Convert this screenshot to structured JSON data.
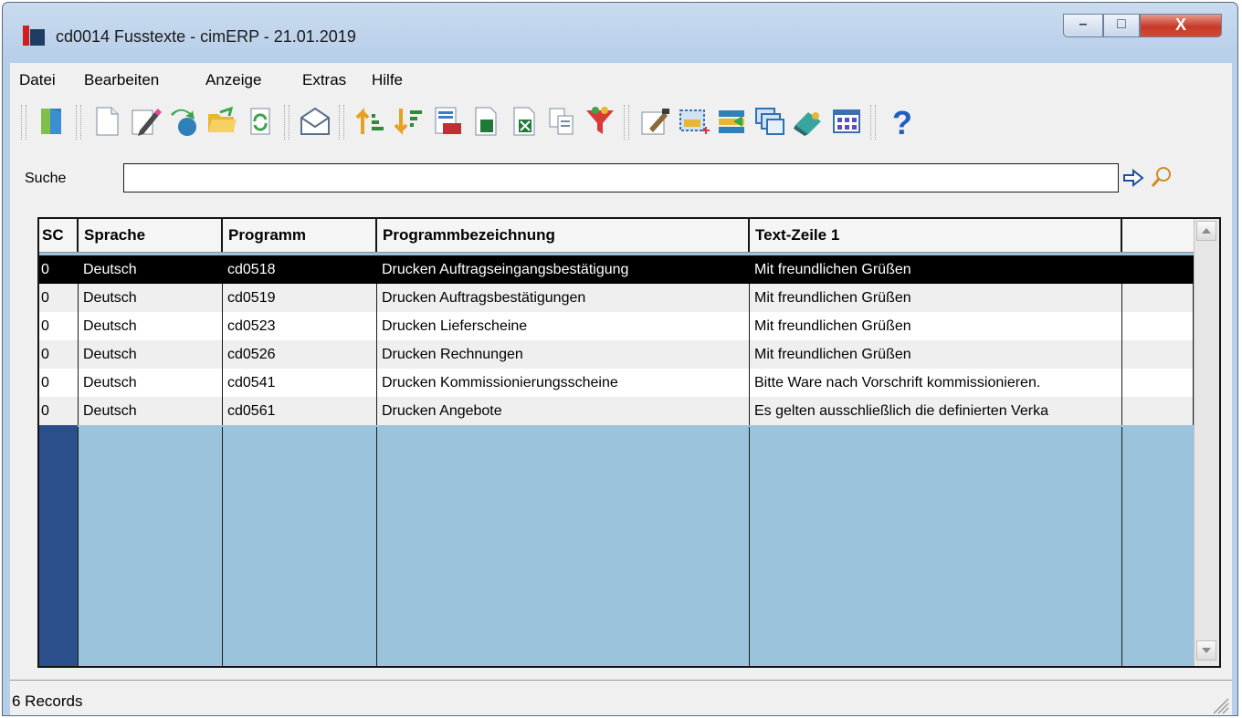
{
  "window": {
    "title": "cd0014 Fusstexte - cimERP - 21.01.2019",
    "controls": {
      "minimize": "–",
      "maximize": "□",
      "close": "X"
    }
  },
  "menu": {
    "items": [
      {
        "label": "Datei"
      },
      {
        "label": "Bearbeiten"
      },
      {
        "label": "Anzeige"
      },
      {
        "label": "Extras"
      },
      {
        "label": "Hilfe"
      }
    ]
  },
  "toolbar": {
    "buttons": [
      {
        "icon": "exit-door-icon"
      },
      {
        "icon": "new-document-icon"
      },
      {
        "icon": "edit-pencil-icon"
      },
      {
        "icon": "copy-record-icon"
      },
      {
        "icon": "open-folder-icon"
      },
      {
        "icon": "refresh-icon"
      },
      {
        "icon": "envelope-icon"
      },
      {
        "icon": "sort-ascending-icon"
      },
      {
        "icon": "sort-descending-icon"
      },
      {
        "icon": "number-list-icon"
      },
      {
        "icon": "export-icon"
      },
      {
        "icon": "excel-export-icon"
      },
      {
        "icon": "copy-pages-icon"
      },
      {
        "icon": "filter-funnel-icon"
      },
      {
        "icon": "settings-edit-icon"
      },
      {
        "icon": "select-area-icon"
      },
      {
        "icon": "transfer-icon"
      },
      {
        "icon": "windows-icon"
      },
      {
        "icon": "eraser-icon"
      },
      {
        "icon": "grid-view-icon"
      },
      {
        "icon": "help-icon"
      }
    ]
  },
  "search": {
    "label": "Suche",
    "value": "",
    "placeholder": ""
  },
  "table": {
    "columns": [
      "SC",
      "Sprache",
      "Programm",
      "Programmbezeichnung",
      "Text-Zeile 1"
    ],
    "rows": [
      {
        "sc": "0",
        "sprache": "Deutsch",
        "programm": "cd0518",
        "bezeichnung": "Drucken Auftragseingangsbestätigung",
        "text": "Mit freundlichen Grüßen"
      },
      {
        "sc": "0",
        "sprache": "Deutsch",
        "programm": "cd0519",
        "bezeichnung": "Drucken Auftragsbestätigungen",
        "text": "Mit freundlichen Grüßen"
      },
      {
        "sc": "0",
        "sprache": "Deutsch",
        "programm": "cd0523",
        "bezeichnung": "Drucken Lieferscheine",
        "text": "Mit freundlichen Grüßen"
      },
      {
        "sc": "0",
        "sprache": "Deutsch",
        "programm": "cd0526",
        "bezeichnung": "Drucken Rechnungen",
        "text": "Mit freundlichen Grüßen"
      },
      {
        "sc": "0",
        "sprache": "Deutsch",
        "programm": "cd0541",
        "bezeichnung": "Drucken Kommissionierungsscheine",
        "text": "Bitte Ware nach Vorschrift kommissionieren."
      },
      {
        "sc": "0",
        "sprache": "Deutsch",
        "programm": "cd0561",
        "bezeichnung": "Drucken Angebote",
        "text": "Es gelten ausschließlich die definierten Verka"
      }
    ],
    "selected_row": 0
  },
  "status": {
    "records": "6 Records"
  },
  "colors": {
    "grid_empty": "#9cc3dc",
    "selection": "#000000",
    "titlebar": "#c9dbef",
    "brand_red": "#d21e1e"
  }
}
